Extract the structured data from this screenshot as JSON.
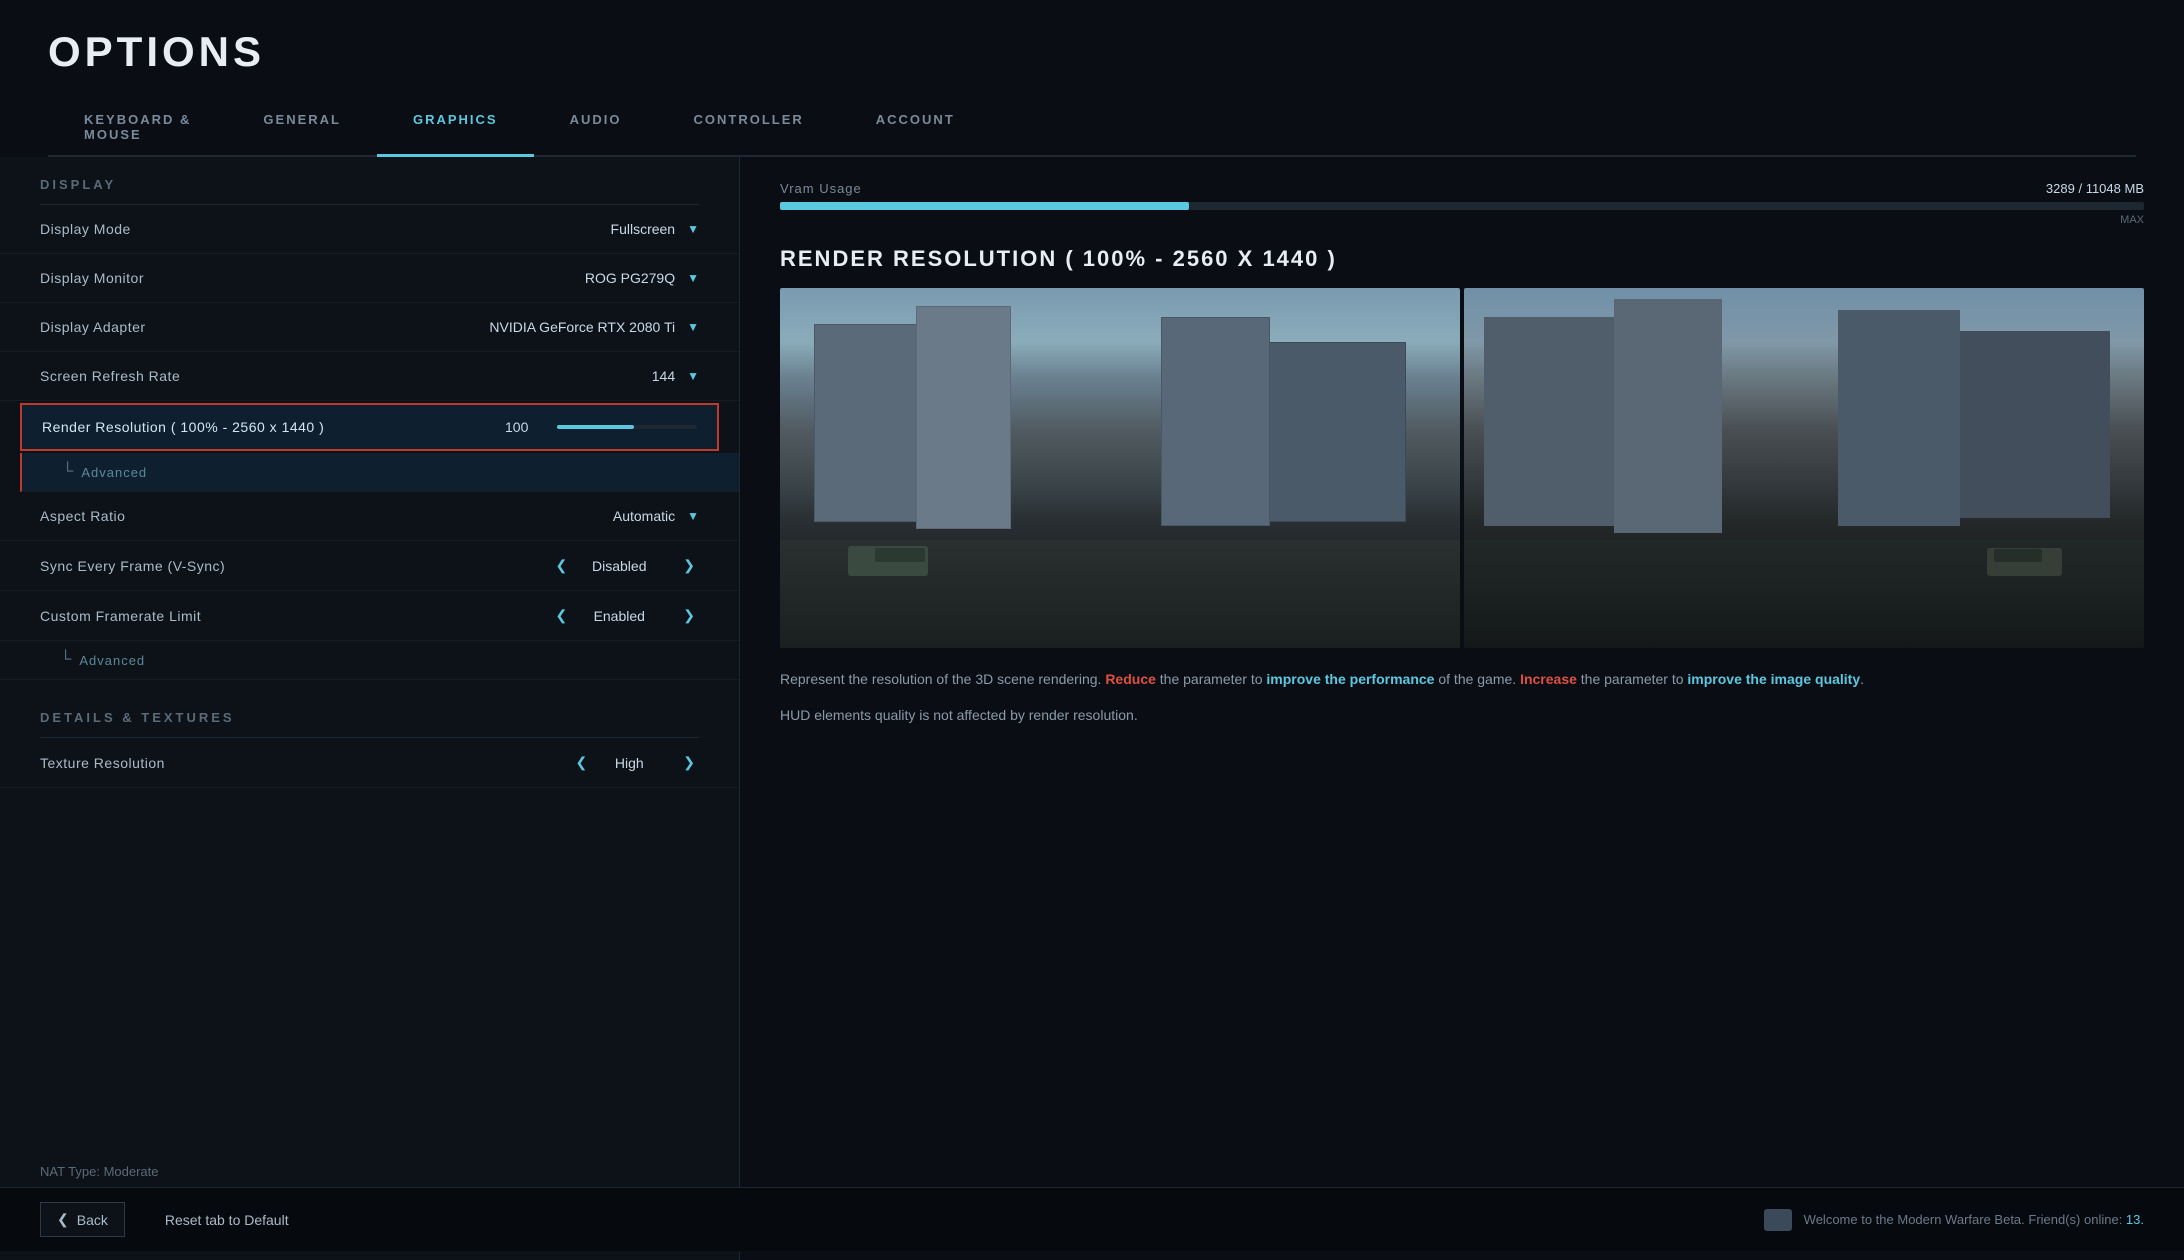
{
  "page": {
    "title": "OPTIONS"
  },
  "tabs": [
    {
      "id": "keyboard",
      "label": "KEYBOARD &\nMOUSE",
      "active": false
    },
    {
      "id": "general",
      "label": "GENERAL",
      "active": false
    },
    {
      "id": "graphics",
      "label": "GRAPHICS",
      "active": true
    },
    {
      "id": "audio",
      "label": "AUDIO",
      "active": false
    },
    {
      "id": "controller",
      "label": "CONTROLLER",
      "active": false
    },
    {
      "id": "account",
      "label": "ACCOUNT",
      "active": false
    }
  ],
  "sections": {
    "display": {
      "label": "DISPLAY",
      "settings": [
        {
          "name": "Display Mode",
          "value": "Fullscreen",
          "type": "dropdown"
        },
        {
          "name": "Display Monitor",
          "value": "ROG PG279Q",
          "type": "dropdown"
        },
        {
          "name": "Display Adapter",
          "value": "NVIDIA GeForce RTX 2080 Ti",
          "type": "dropdown"
        },
        {
          "name": "Screen Refresh Rate",
          "value": "144",
          "type": "dropdown"
        },
        {
          "name": "Render Resolution ( 100% - 2560 x 1440 )",
          "value": "100",
          "type": "slider",
          "sliderPercent": 55,
          "highlighted": true
        },
        {
          "name": "Advanced",
          "type": "advanced-sub",
          "highlighted": true
        },
        {
          "name": "Aspect Ratio",
          "value": "Automatic",
          "type": "dropdown"
        },
        {
          "name": "Sync Every Frame (V-Sync)",
          "value": "Disabled",
          "type": "lr-arrows"
        },
        {
          "name": "Custom Framerate Limit",
          "value": "Enabled",
          "type": "lr-arrows"
        }
      ],
      "advanced2": {
        "name": "Advanced",
        "type": "advanced-sub2"
      }
    },
    "detailsTextures": {
      "label": "DETAILS & TEXTURES",
      "settings": [
        {
          "name": "Texture Resolution",
          "value": "High",
          "type": "lr-arrows"
        }
      ]
    }
  },
  "vram": {
    "label": "Vram Usage",
    "used": "3289",
    "total": "11048",
    "unit": "MB",
    "fillPercent": 30,
    "maxLabel": "MAX"
  },
  "renderResolution": {
    "title": "RENDER RESOLUTION ( 100% - 2560 X 1440 )",
    "description": {
      "part1": "Represent the resolution of the 3D scene rendering. ",
      "reduce": "Reduce",
      "part2": " the parameter to ",
      "improve_perf": "improve the performance",
      "part3": " of the game. ",
      "increase": "Increase",
      "part4": " the parameter to ",
      "improve_quality": "improve the image quality",
      "part5": "."
    },
    "hudNote": "HUD elements quality is not affected by render resolution."
  },
  "footer": {
    "backLabel": "Back",
    "resetLabel": "Reset tab to Default",
    "welcomeText": "Welcome to the Modern Warfare Beta. Friend(s) online: ",
    "friendCount": "13."
  },
  "natType": "NAT Type: Moderate"
}
